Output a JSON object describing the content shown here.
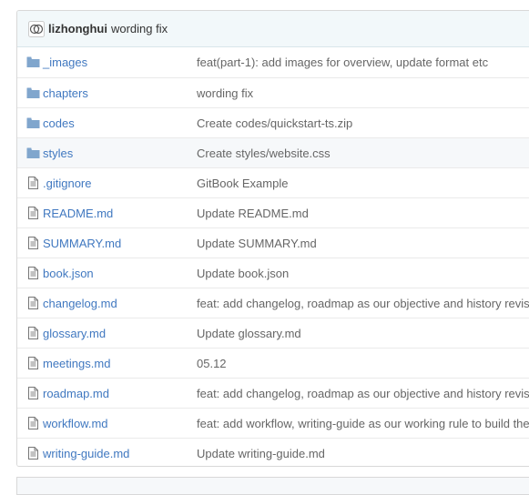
{
  "commit": {
    "author": "lizhonghui",
    "message": "wording fix"
  },
  "files": [
    {
      "type": "dir",
      "icon": "folder-icon",
      "name": "_images",
      "message": "feat(part-1): add images for overview, update format etc"
    },
    {
      "type": "dir",
      "icon": "folder-icon",
      "name": "chapters",
      "message": "wording fix"
    },
    {
      "type": "dir",
      "icon": "folder-icon",
      "name": "codes",
      "message": "Create codes/quickstart-ts.zip"
    },
    {
      "type": "dir",
      "icon": "folder-icon",
      "name": "styles",
      "message": "Create styles/website.css"
    },
    {
      "type": "file",
      "icon": "file-icon",
      "name": ".gitignore",
      "message": "GitBook Example"
    },
    {
      "type": "file",
      "icon": "file-icon",
      "name": "README.md",
      "message": "Update README.md"
    },
    {
      "type": "file",
      "icon": "file-icon",
      "name": "SUMMARY.md",
      "message": "Update SUMMARY.md"
    },
    {
      "type": "file",
      "icon": "file-icon",
      "name": "book.json",
      "message": "Update book.json"
    },
    {
      "type": "file",
      "icon": "file-icon",
      "name": "changelog.md",
      "message": "feat: add changelog, roadmap as our objective and history revis"
    },
    {
      "type": "file",
      "icon": "file-icon",
      "name": "glossary.md",
      "message": "Update glossary.md"
    },
    {
      "type": "file",
      "icon": "file-icon",
      "name": "meetings.md",
      "message": "05.12"
    },
    {
      "type": "file",
      "icon": "file-icon",
      "name": "roadmap.md",
      "message": "feat: add changelog, roadmap as our objective and history revis"
    },
    {
      "type": "file",
      "icon": "file-icon",
      "name": "workflow.md",
      "message": "feat: add workflow, writing-guide as our working rule to build the"
    },
    {
      "type": "file",
      "icon": "file-icon",
      "name": "writing-guide.md",
      "message": "Update writing-guide.md"
    }
  ],
  "highlighted_row": "styles",
  "colors": {
    "link": "#4078c0",
    "folder": "#80a6cd",
    "file_icon": "#777777",
    "commit_bar": "#f2f8fa",
    "row_hover": "#f6f8fa"
  }
}
